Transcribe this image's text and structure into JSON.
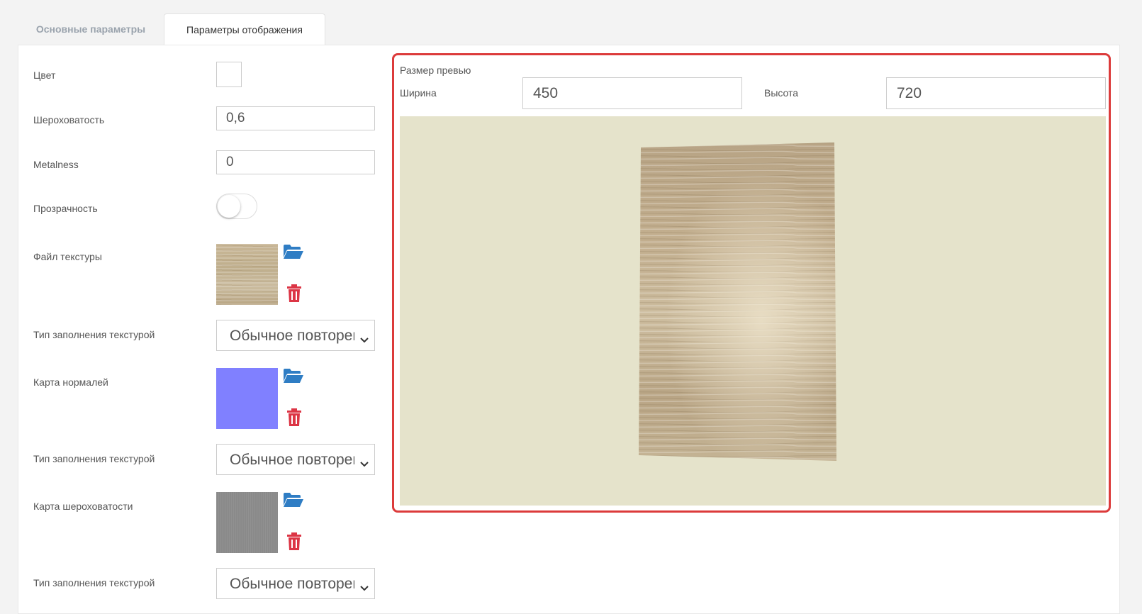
{
  "tabs": [
    {
      "label": "Основные параметры",
      "active": false
    },
    {
      "label": "Параметры отображения",
      "active": true
    }
  ],
  "form": {
    "color": {
      "label": "Цвет",
      "value": "#ffffff"
    },
    "roughness": {
      "label": "Шероховатость",
      "value": "0,6"
    },
    "metalness": {
      "label": "Metalness",
      "value": "0"
    },
    "transparency": {
      "label": "Прозрачность",
      "enabled": false
    },
    "texture_file": {
      "label": "Файл текстуры",
      "open_icon": "folder-open-icon",
      "delete_icon": "trash-icon"
    },
    "texture_fill_1": {
      "label": "Тип заполнения текстурой",
      "selected": "Обычное повторение"
    },
    "normal_map": {
      "label": "Карта нормалей",
      "color": "#8080ff",
      "open_icon": "folder-open-icon",
      "delete_icon": "trash-icon"
    },
    "texture_fill_2": {
      "label": "Тип заполнения текстурой",
      "selected": "Обычное повторение"
    },
    "roughness_map": {
      "label": "Карта шероховатости",
      "color": "#8a8a8a",
      "open_icon": "folder-open-icon",
      "delete_icon": "trash-icon"
    },
    "texture_fill_3": {
      "label": "Тип заполнения текстурой",
      "selected": "Обычное повторение"
    }
  },
  "preview": {
    "title": "Размер превью",
    "width_label": "Ширина",
    "width_value": "450",
    "height_label": "Высота",
    "height_value": "720",
    "background": "#e5e3cb",
    "highlight_color": "#dc3b3b"
  },
  "colors": {
    "accent_blue": "#2f7dc4",
    "delete_red": "#dc3545"
  }
}
